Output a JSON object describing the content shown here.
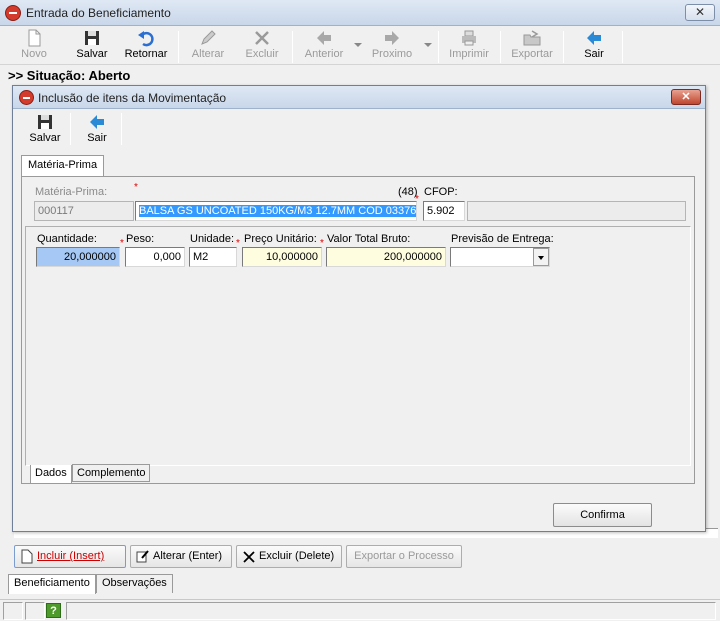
{
  "main_window": {
    "title": "Entrada do Beneficiamento",
    "close_label": "✕",
    "toolbar": [
      {
        "key": "novo",
        "label": "Novo",
        "icon": "new-file-icon",
        "enabled": false
      },
      {
        "key": "salvar",
        "label": "Salvar",
        "icon": "floppy-disk-icon",
        "enabled": true
      },
      {
        "key": "retornar",
        "label": "Retornar",
        "icon": "undo-arrow-icon",
        "enabled": true
      },
      {
        "key": "alterar",
        "label": "Alterar",
        "icon": "pencil-icon",
        "enabled": false
      },
      {
        "key": "excluir",
        "label": "Excluir",
        "icon": "x-delete-icon",
        "enabled": false
      },
      {
        "key": "anterior",
        "label": "Anterior",
        "icon": "arrow-left-icon",
        "enabled": false
      },
      {
        "key": "proximo",
        "label": "Proximo",
        "icon": "arrow-right-icon",
        "enabled": false
      },
      {
        "key": "imprimir",
        "label": "Imprimir",
        "icon": "printer-icon",
        "enabled": false
      },
      {
        "key": "exportar",
        "label": "Exportar",
        "icon": "export-folder-icon",
        "enabled": false
      },
      {
        "key": "sair",
        "label": "Sair",
        "icon": "exit-arrow-icon",
        "enabled": true
      }
    ],
    "situacao": ">> Situação: Aberto",
    "action_buttons": {
      "incluir": "Incluir (Insert)",
      "alterar": "Alterar (Enter)",
      "excluir": "Excluir (Delete)",
      "exportar": "Exportar o Processo"
    },
    "bottom_tabs": {
      "beneficiamento": "Beneficiamento",
      "observacoes": "Observações"
    },
    "status_help": "?"
  },
  "dialog": {
    "title": "Inclusão de itens da Movimentação",
    "close_label": "✕",
    "toolbar": {
      "salvar": "Salvar",
      "sair": "Sair"
    },
    "tab_label": "Matéria-Prima",
    "materia_prima": {
      "label": "Matéria-Prima:",
      "code": "000117",
      "description": "BALSA GS UNCOATED 150KG/M3 12.7MM  COD 03376",
      "count": "(48)"
    },
    "cfop": {
      "label": "CFOP:",
      "value": "5.902",
      "description": ""
    },
    "quantidade": {
      "label": "Quantidade:",
      "value": "20,000000"
    },
    "peso": {
      "label": "Peso:",
      "value": "0,000"
    },
    "unidade": {
      "label": "Unidade:",
      "value": "M2"
    },
    "preco_unitario": {
      "label": "Preço Unitário:",
      "value": "10,000000"
    },
    "valor_total_bruto": {
      "label": "Valor Total Bruto:",
      "value": "200,000000"
    },
    "previsao_entrega": {
      "label": "Previsão de Entrega:",
      "value": ""
    },
    "sub_tabs": {
      "dados": "Dados",
      "complemento": "Complemento"
    },
    "confirm_label": "Confirma"
  },
  "colors": {
    "title_bar": "#c9d7ea",
    "close_red": "#c0462e",
    "quantity_bg": "#a6c8f4",
    "price_bg": "#fffde0",
    "selection": "#3399ff",
    "required": "#dd0000"
  }
}
